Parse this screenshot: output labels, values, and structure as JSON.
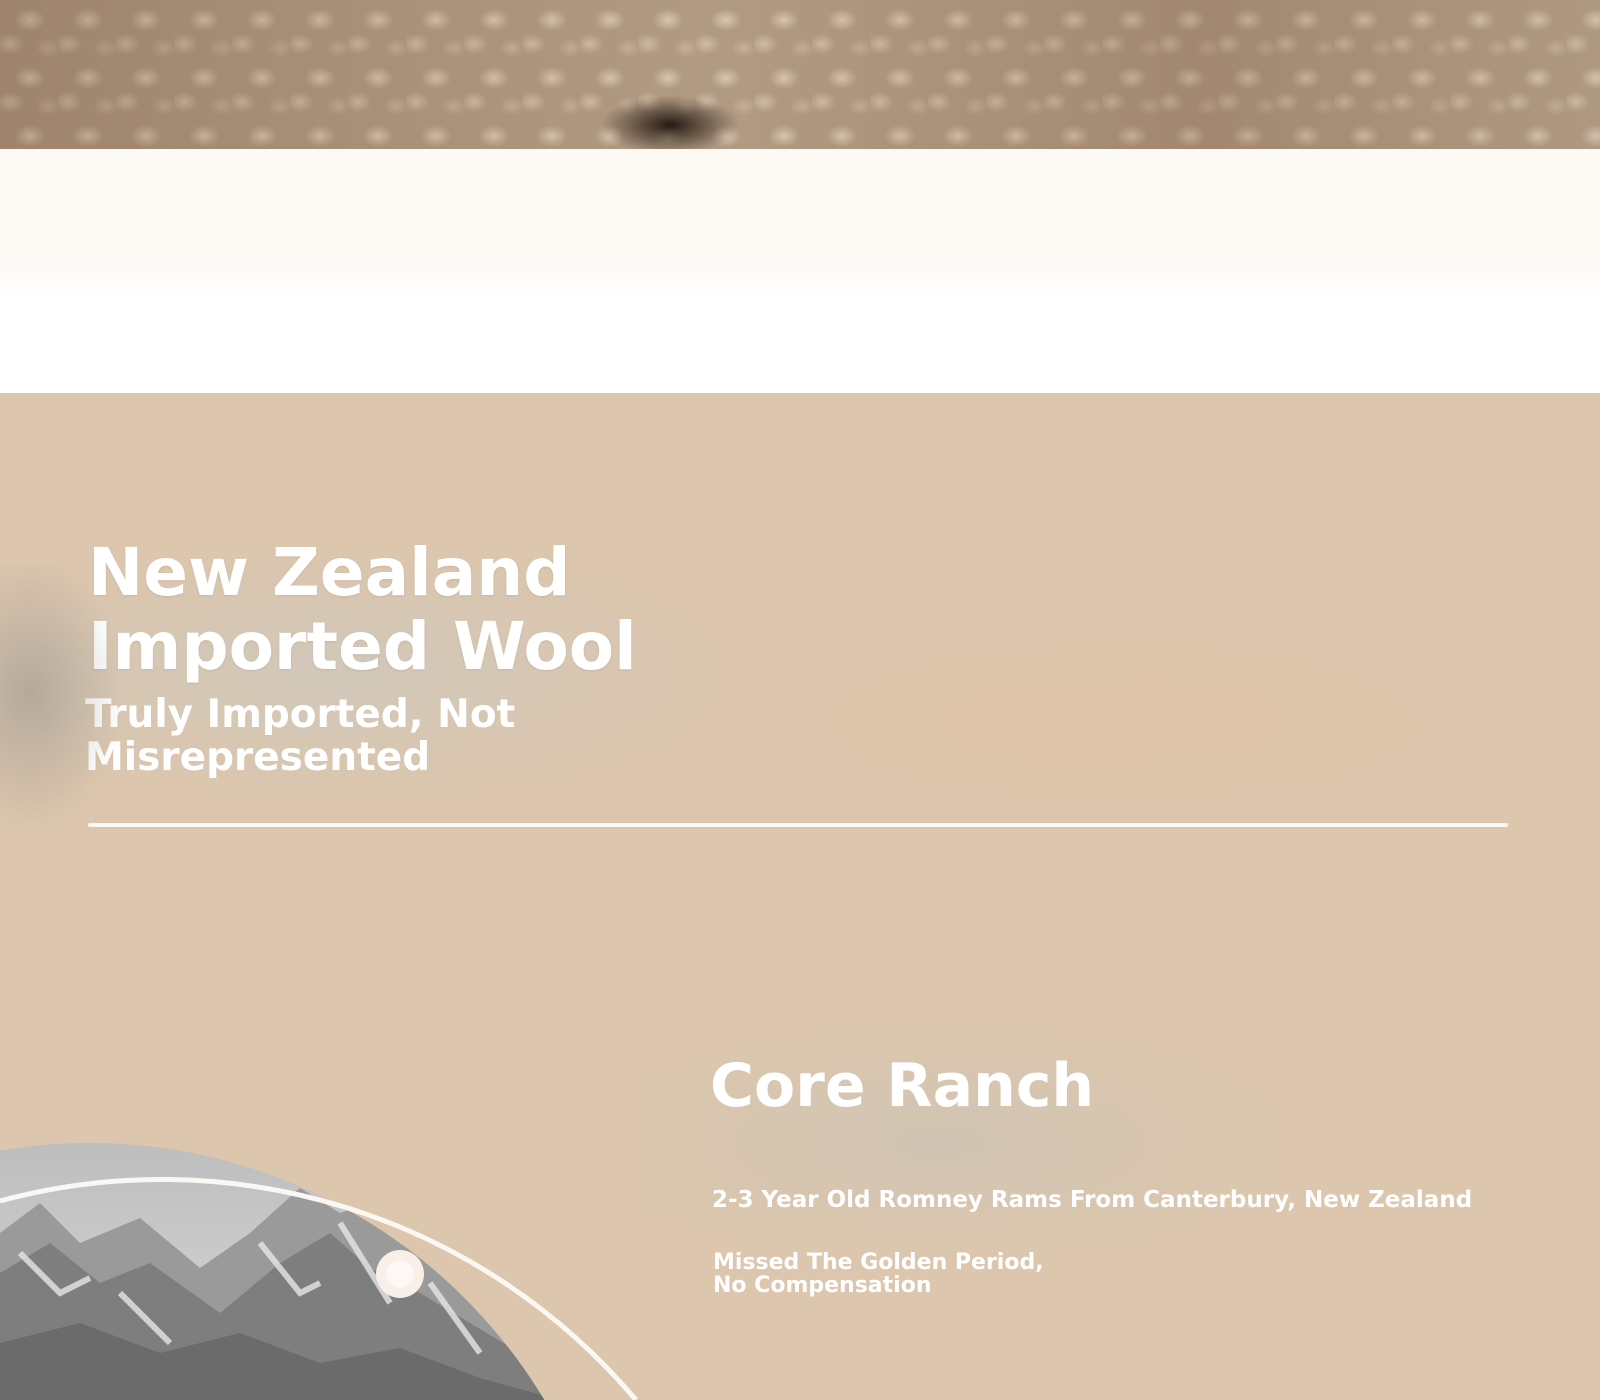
{
  "hero": {
    "title": "New Zealand Imported Wool",
    "subtitle": "Truly Imported, Not Misrepresented"
  },
  "ranch": {
    "title": "Core Ranch",
    "origin": "2-3 Year Old Romney Rams From Canterbury, New Zealand",
    "note": "Missed The Golden Period, No Compensation"
  },
  "colors": {
    "section_background": "#dcc6ad",
    "text": "#ffffff",
    "divider": "#fbf7f2"
  }
}
